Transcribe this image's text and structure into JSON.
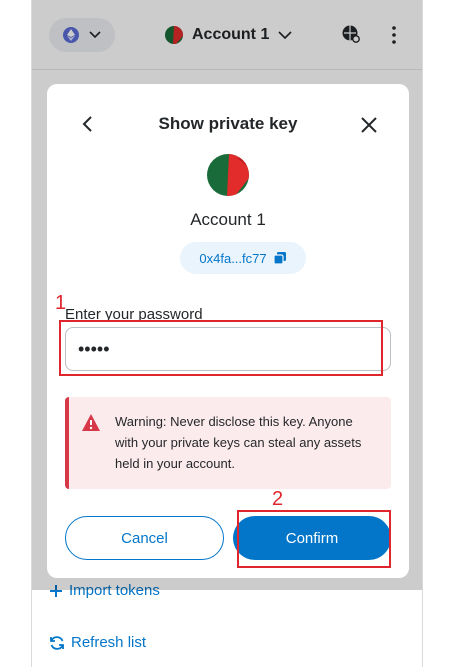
{
  "header": {
    "account_name": "Account 1"
  },
  "background_list": {
    "import_tokens": "Import tokens",
    "refresh_list": "Refresh list"
  },
  "modal": {
    "title": "Show private key",
    "account_name": "Account 1",
    "address": "0x4fa...fc77",
    "password_label": "Enter your password",
    "password_value": "•••••",
    "warning": "Warning: Never disclose this key. Anyone with your private keys can steal any assets held in your account.",
    "cancel_label": "Cancel",
    "confirm_label": "Confirm"
  },
  "annotations": {
    "step1": "1",
    "step2": "2"
  },
  "colors": {
    "accent": "#0376c9",
    "danger": "#d73847",
    "annotation": "#e0262d"
  }
}
